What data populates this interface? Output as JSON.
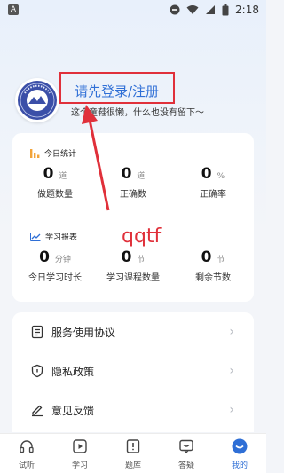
{
  "status_bar": {
    "app_badge": "A",
    "time": "2:18"
  },
  "profile": {
    "login_prompt": "请先登录/注册",
    "tagline": "这个童鞋很懒，什么也没有留下～"
  },
  "today_stats": {
    "title": "今日统计",
    "items": [
      {
        "value": "0",
        "unit": "道",
        "label": "做题数量"
      },
      {
        "value": "0",
        "unit": "道",
        "label": "正确数"
      },
      {
        "value": "0",
        "unit": "%",
        "label": "正确率"
      }
    ]
  },
  "study_report": {
    "title": "学习报表",
    "items": [
      {
        "value": "0",
        "unit": "分钟",
        "label": "今日学习时长"
      },
      {
        "value": "0",
        "unit": "节",
        "label": "学习课程数量"
      },
      {
        "value": "0",
        "unit": "节",
        "label": "剩余节数"
      }
    ]
  },
  "menu": {
    "items": [
      {
        "label": "服务使用协议",
        "icon": "document-icon"
      },
      {
        "label": "隐私政策",
        "icon": "shield-icon"
      },
      {
        "label": "意见反馈",
        "icon": "pencil-icon"
      }
    ],
    "chevron": "›"
  },
  "annotation": {
    "text": "qqtf",
    "color": "#e0303a"
  },
  "tabs": [
    {
      "label": "试听",
      "icon": "headphones-icon",
      "active": false
    },
    {
      "label": "学习",
      "icon": "play-icon",
      "active": false
    },
    {
      "label": "题库",
      "icon": "exam-icon",
      "active": false
    },
    {
      "label": "答疑",
      "icon": "chat-icon",
      "active": false
    },
    {
      "label": "我的",
      "icon": "profile-icon",
      "active": true
    }
  ],
  "colors": {
    "accent": "#2f6fd6",
    "highlight_box": "#e0303a",
    "report_icon": "#f2a43a"
  }
}
